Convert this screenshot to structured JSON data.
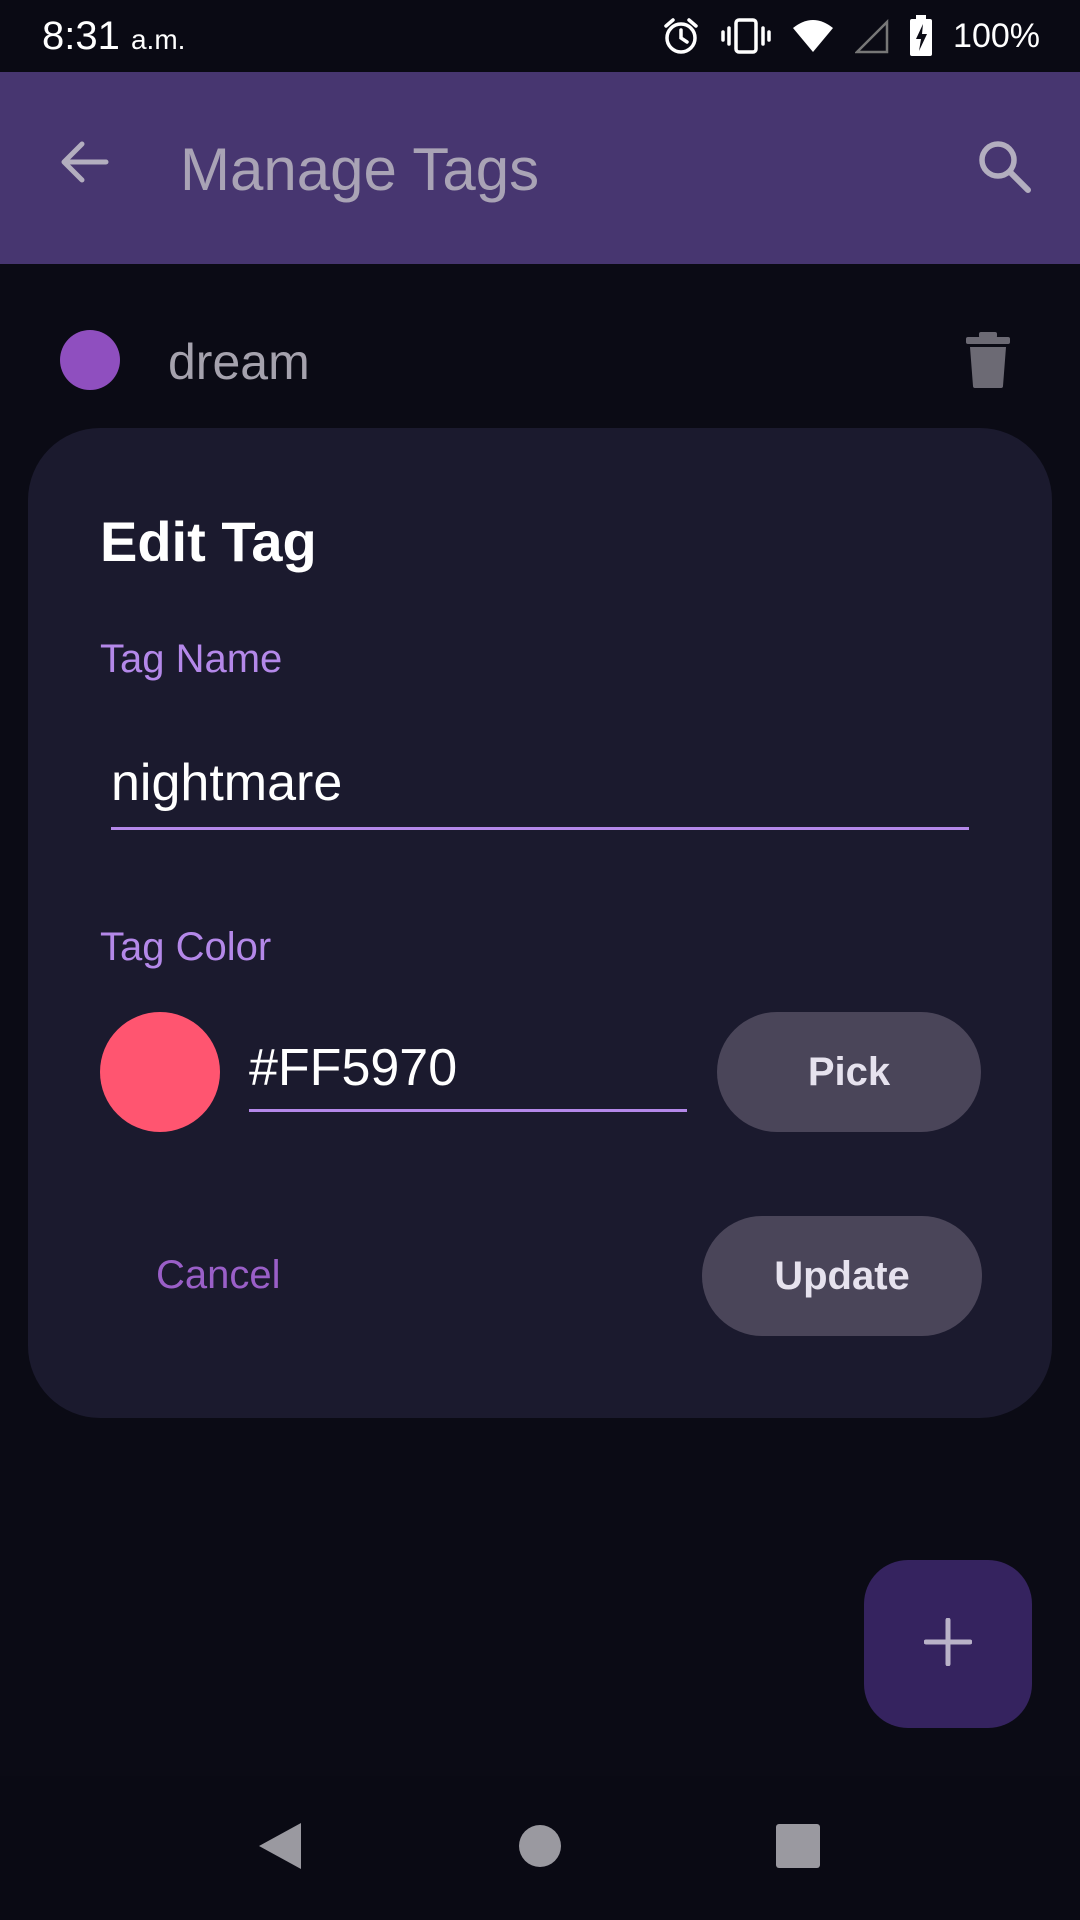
{
  "status_bar": {
    "time": "8:31",
    "ampm": "a.m.",
    "battery": "100%",
    "icons": [
      "alarm-icon",
      "vibrate-icon",
      "wifi-icon",
      "signal-icon",
      "battery-charging-icon"
    ]
  },
  "app_bar": {
    "title": "Manage Tags",
    "back_icon": "arrow-back-icon",
    "search_icon": "search-icon"
  },
  "tag_list": {
    "items": [
      {
        "name": "dream",
        "color": "#8f4fbf"
      }
    ]
  },
  "dialog": {
    "title": "Edit Tag",
    "name_label": "Tag Name",
    "name_value": "nightmare",
    "color_label": "Tag Color",
    "color_value": "#FF5970",
    "swatch_color": "#ff5570",
    "pick_label": "Pick",
    "cancel_label": "Cancel",
    "update_label": "Update"
  },
  "fab": {
    "icon": "plus-icon"
  },
  "nav_bar": {
    "icons": [
      "nav-back-icon",
      "nav-home-icon",
      "nav-recents-icon"
    ]
  },
  "colors": {
    "app_bar": "#473670",
    "dialog_bg": "#1b1a2e",
    "accent_label": "#b488e9",
    "cancel_text": "#9a5fc8",
    "button_bg": "#4a4559",
    "fab_bg": "#35235f"
  }
}
